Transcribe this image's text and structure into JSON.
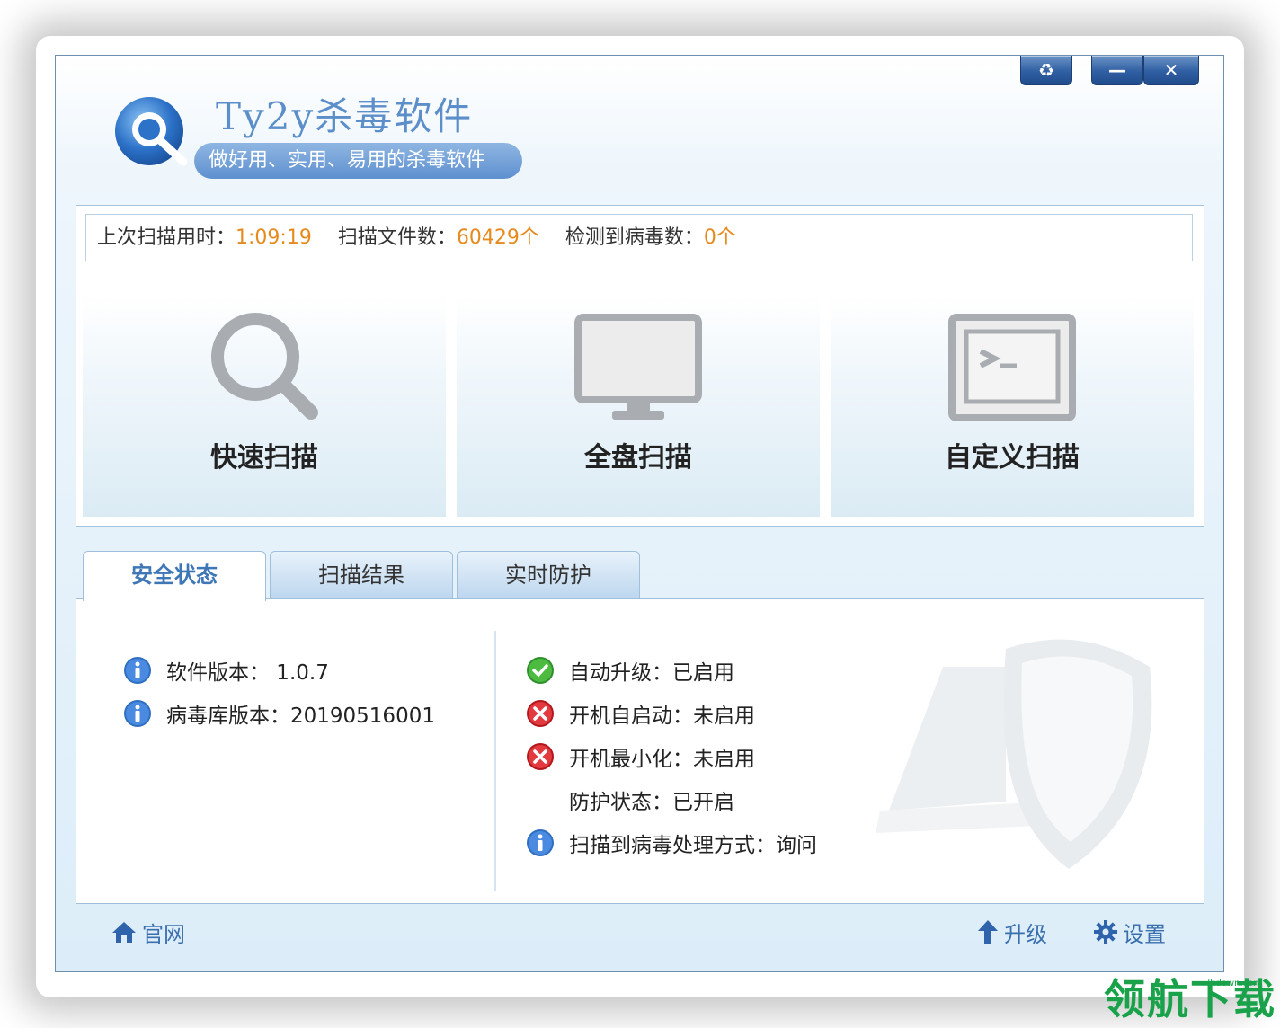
{
  "window": {
    "app_title": "Ty2y杀毒软件",
    "slogan": "做好用、实用、易用的杀毒软件",
    "controls": {
      "skin": "♻",
      "minimize": "—",
      "close": "✕"
    }
  },
  "stats": {
    "last_scan_label": "上次扫描用时：",
    "last_scan_value": "1:09:19",
    "files_label": "扫描文件数：",
    "files_value": "60429个",
    "virus_label": "检测到病毒数：",
    "virus_value": "0个"
  },
  "scan_buttons": [
    {
      "label": "快速扫描",
      "icon": "magnifier-icon"
    },
    {
      "label": "全盘扫描",
      "icon": "monitor-icon"
    },
    {
      "label": "自定义扫描",
      "icon": "terminal-icon"
    }
  ],
  "tabs": [
    {
      "label": "安全状态",
      "active": true
    },
    {
      "label": "扫描结果",
      "active": false
    },
    {
      "label": "实时防护",
      "active": false
    }
  ],
  "security_status": {
    "left": [
      {
        "icon": "info-icon",
        "text": "软件版本： 1.0.7"
      },
      {
        "icon": "info-icon",
        "text": "病毒库版本：20190516001"
      }
    ],
    "right": [
      {
        "icon": "check-icon",
        "text": "自动升级：已启用"
      },
      {
        "icon": "error-icon",
        "text": "开机自启动：未启用"
      },
      {
        "icon": "error-icon",
        "text": "开机最小化：未启用"
      },
      {
        "icon": "none",
        "text": "防护状态：已开启"
      },
      {
        "icon": "info-icon",
        "text": "扫描到病毒处理方式：询问"
      }
    ]
  },
  "footer": {
    "website": "官网",
    "upgrade": "升级",
    "settings": "设置"
  },
  "watermark": {
    "brand": "领航下载",
    "url": "lhdown.com"
  },
  "colors": {
    "accent_blue": "#3a6fae",
    "value_orange": "#e68a1e",
    "ok_green": "#3aa23a",
    "error_red": "#d9262c"
  }
}
